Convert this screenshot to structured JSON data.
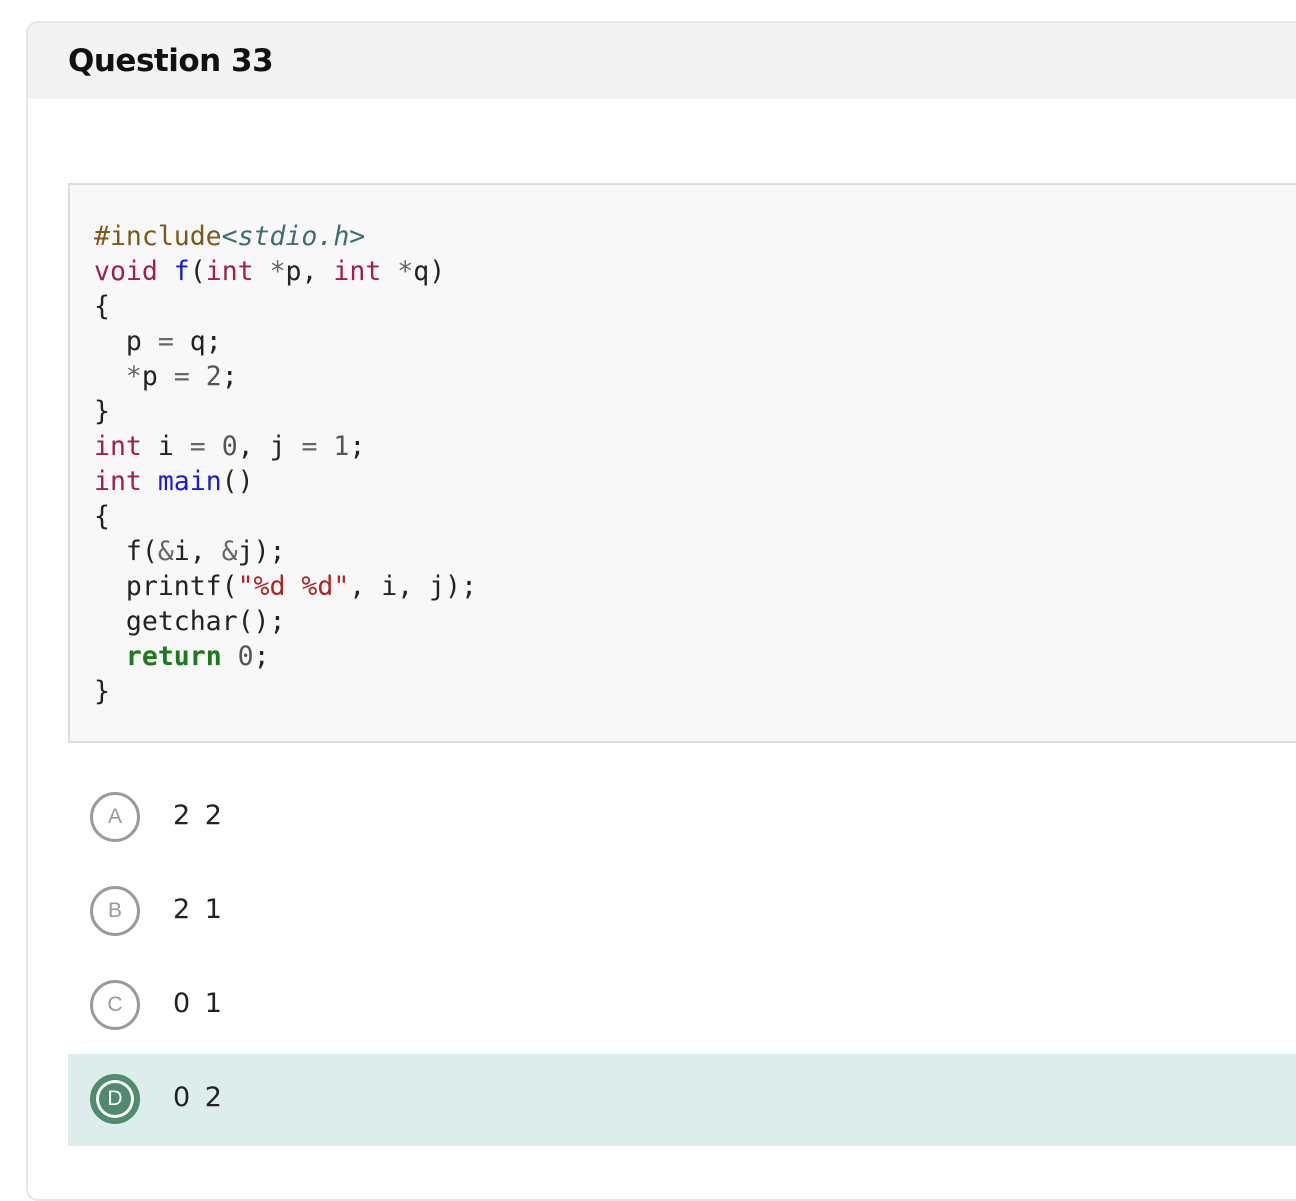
{
  "question": {
    "title": "Question 33"
  },
  "code": {
    "line1_pre": "#include",
    "line1_inc": "<stdio.h>",
    "kw_void": "void",
    "fn_f": "f",
    "kw_int": "int",
    "fn_main": "main",
    "kw_return": "return",
    "str_fmt": "\"%d %d\""
  },
  "options": [
    {
      "letter": "A",
      "text": "2 2",
      "selected": false
    },
    {
      "letter": "B",
      "text": "2 1",
      "selected": false
    },
    {
      "letter": "C",
      "text": "0 1",
      "selected": false
    },
    {
      "letter": "D",
      "text": "0 2",
      "selected": true
    }
  ],
  "colors": {
    "selected_bg": "#dcedec",
    "selected_circle": "#4f8a6c",
    "header_bg": "#f3f3f3"
  }
}
